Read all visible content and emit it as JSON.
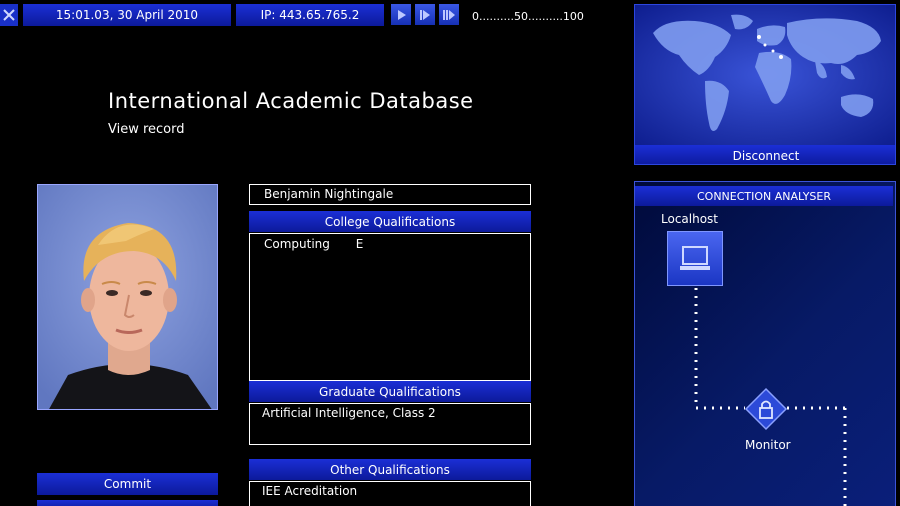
{
  "topbar": {
    "datetime": "15:01.03, 30 April 2010",
    "ip": "IP: 443.65.765.2",
    "speed_scale": "0..........50..........100"
  },
  "header": {
    "title": "International Academic Database",
    "subtitle": "View record"
  },
  "record": {
    "name": "Benjamin Nightingale",
    "college_header": "College Qualifications",
    "college_entries": [
      {
        "subject": "Computing",
        "grade": "E"
      }
    ],
    "graduate_header": "Graduate Qualifications",
    "graduate_entries": [
      "Artificial Intelligence, Class 2"
    ],
    "other_header": "Other Qualifications",
    "other_entries": [
      "IEE Acreditation"
    ]
  },
  "actions": {
    "commit_label": "Commit"
  },
  "world_map": {
    "disconnect_label": "Disconnect"
  },
  "connection_analyser": {
    "title": "CONNECTION ANALYSER",
    "nodes": {
      "localhost": "Localhost",
      "monitor": "Monitor"
    }
  },
  "colors": {
    "accent": "#1a2fd0",
    "background": "#000000",
    "text": "#ffffff"
  },
  "icons": {
    "close": "close-icon",
    "play": "play-icon",
    "fast_forward": "fast-forward-icon",
    "fastest": "fastest-forward-icon",
    "computer": "computer-icon",
    "lock": "lock-icon"
  }
}
